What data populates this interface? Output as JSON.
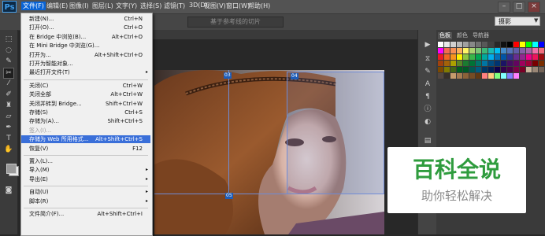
{
  "menubar": {
    "logo": "Ps",
    "items": [
      {
        "label": "文件(F)",
        "active": true
      },
      {
        "label": "编辑(E)"
      },
      {
        "label": "图像(I)"
      },
      {
        "label": "图层(L)"
      },
      {
        "label": "文字(Y)"
      },
      {
        "label": "选择(S)"
      },
      {
        "label": "滤镜(T)"
      },
      {
        "label": "3D(D)"
      },
      {
        "label": "视图(V)"
      },
      {
        "label": "窗口(W)"
      },
      {
        "label": "帮助(H)"
      }
    ],
    "window_buttons": [
      "–",
      "□",
      "×"
    ]
  },
  "options_bar": {
    "slice_button": "基于参考线的切片",
    "workspace": "摄影"
  },
  "file_menu": {
    "items": [
      {
        "label": "新建(N)...",
        "shortcut": "Ctrl+N"
      },
      {
        "label": "打开(O)...",
        "shortcut": "Ctrl+O"
      },
      {
        "label": "在 Bridge 中浏览(B)...",
        "shortcut": "Alt+Ctrl+O"
      },
      {
        "label": "在 Mini Bridge 中浏览(G)...",
        "shortcut": ""
      },
      {
        "label": "打开为...",
        "shortcut": "Alt+Shift+Ctrl+O"
      },
      {
        "label": "打开为智能对象...",
        "shortcut": ""
      },
      {
        "label": "最近打开文件(T)",
        "shortcut": "",
        "submenu": true
      },
      {
        "label": "关闭(C)",
        "shortcut": "Ctrl+W"
      },
      {
        "label": "关闭全部",
        "shortcut": "Alt+Ctrl+W"
      },
      {
        "label": "关闭并转到 Bridge...",
        "shortcut": "Shift+Ctrl+W"
      },
      {
        "label": "存储(S)",
        "shortcut": "Ctrl+S"
      },
      {
        "label": "存储为(A)...",
        "shortcut": "Shift+Ctrl+S"
      },
      {
        "label": "签入(I)...",
        "shortcut": "",
        "disabled": true
      },
      {
        "label": "存储为 Web 所用格式...",
        "shortcut": "Alt+Shift+Ctrl+S",
        "highlighted": true
      },
      {
        "label": "恢复(V)",
        "shortcut": "F12"
      },
      {
        "label": "置入(L)...",
        "shortcut": ""
      },
      {
        "label": "导入(M)",
        "shortcut": "",
        "submenu": true
      },
      {
        "label": "导出(E)",
        "shortcut": "",
        "submenu": true
      },
      {
        "label": "自动(U)",
        "shortcut": "",
        "submenu": true
      },
      {
        "label": "脚本(R)",
        "shortcut": "",
        "submenu": true
      },
      {
        "label": "文件简介(F)...",
        "shortcut": "Alt+Shift+Ctrl+I"
      }
    ],
    "submenu_arrow": "▸"
  },
  "canvas": {
    "slice_labels": [
      "03",
      "04",
      "05"
    ]
  },
  "swatches_panel": {
    "tabs": [
      "色板",
      "颜色",
      "导航器"
    ],
    "colors": [
      "#ffffff",
      "#e8e8e8",
      "#d0d0d0",
      "#b8b8b8",
      "#a0a0a0",
      "#888888",
      "#707070",
      "#585858",
      "#404040",
      "#282828",
      "#101010",
      "#000000",
      "#ff0000",
      "#ffff00",
      "#00ff00",
      "#00ffff",
      "#0000ff",
      "#ff00ff",
      "#f26c4f",
      "#f68e55",
      "#fbaf5c",
      "#fff467",
      "#acd372",
      "#7cc576",
      "#3bb878",
      "#1abbb4",
      "#00bff3",
      "#438ccb",
      "#5574b9",
      "#605ca8",
      "#855fa8",
      "#a763a8",
      "#f06ea9",
      "#f26d7d",
      "#ed1c24",
      "#f26522",
      "#f7941d",
      "#fff200",
      "#8dc63f",
      "#39b54a",
      "#00a651",
      "#00a99d",
      "#00aeef",
      "#0072bc",
      "#0054a6",
      "#2e3192",
      "#662d91",
      "#92278f",
      "#ec008c",
      "#ed145b",
      "#9e0b0f",
      "#a0410d",
      "#a36209",
      "#aba000",
      "#598527",
      "#1a7b30",
      "#007236",
      "#00746b",
      "#0076a3",
      "#004b80",
      "#003471",
      "#1b1464",
      "#440e62",
      "#630460",
      "#9e005d",
      "#9e0039",
      "#790000",
      "#7b2e00",
      "#7d4900",
      "#827b00",
      "#406618",
      "#005e20",
      "#005826",
      "#005952",
      "#005b7f",
      "#003663",
      "#002157",
      "#0d004c",
      "#32004b",
      "#4b0049",
      "#7b0046",
      "#7a0026",
      "#c7b299",
      "#998675",
      "#736357",
      "#534741",
      "#37302a",
      "#c69c6d",
      "#a67c52",
      "#8c6239",
      "#754c24",
      "#603913",
      "#ff8080",
      "#ffcc80",
      "#80ff80",
      "#80ffff",
      "#8080ff",
      "#ff80ff"
    ]
  },
  "watermark": {
    "title": "百科全说",
    "subtitle": "助你轻松解决"
  }
}
